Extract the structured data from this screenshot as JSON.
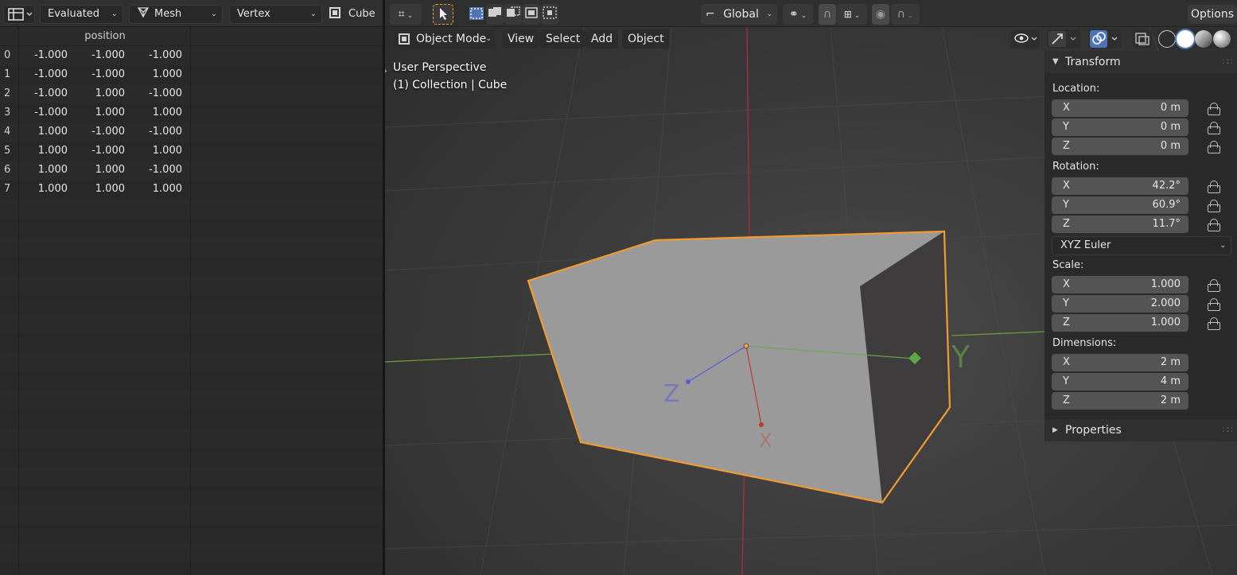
{
  "spreadsheet": {
    "header": {
      "evaluated_dd": "Evaluated",
      "geometry_dd": "Mesh",
      "domain_dd": "Vertex",
      "object_name": "Cube"
    },
    "column_header": "position",
    "rows": [
      {
        "index": "0",
        "x": "-1.000",
        "y": "-1.000",
        "z": "-1.000"
      },
      {
        "index": "1",
        "x": "-1.000",
        "y": "-1.000",
        "z": "1.000"
      },
      {
        "index": "2",
        "x": "-1.000",
        "y": "1.000",
        "z": "-1.000"
      },
      {
        "index": "3",
        "x": "-1.000",
        "y": "1.000",
        "z": "1.000"
      },
      {
        "index": "4",
        "x": "1.000",
        "y": "-1.000",
        "z": "-1.000"
      },
      {
        "index": "5",
        "x": "1.000",
        "y": "-1.000",
        "z": "1.000"
      },
      {
        "index": "6",
        "x": "1.000",
        "y": "1.000",
        "z": "-1.000"
      },
      {
        "index": "7",
        "x": "1.000",
        "y": "1.000",
        "z": "1.000"
      }
    ]
  },
  "viewport": {
    "header": {
      "orientation_dd": "Global",
      "options_label": "Options"
    },
    "menu": {
      "mode": "Object Mode",
      "view": "View",
      "select": "Select",
      "add": "Add",
      "object": "Object"
    },
    "overlay": {
      "line1": "User Perspective",
      "line2": "(1) Collection | Cube"
    },
    "gizmo_axes": {
      "x": "X",
      "y": "Y",
      "z": "Z"
    },
    "colors": {
      "x_axis": "#c0392b",
      "y_axis": "#6aa84f",
      "z_axis": "#5b5bd6",
      "selection_outline": "#f29b2e",
      "accent": "#4f74b6"
    }
  },
  "npanel": {
    "transform_title": "Transform",
    "location_label": "Location:",
    "location": [
      {
        "axis": "X",
        "value": "0 m"
      },
      {
        "axis": "Y",
        "value": "0 m"
      },
      {
        "axis": "Z",
        "value": "0 m"
      }
    ],
    "rotation_label": "Rotation:",
    "rotation": [
      {
        "axis": "X",
        "value": "42.2°"
      },
      {
        "axis": "Y",
        "value": "60.9°"
      },
      {
        "axis": "Z",
        "value": "11.7°"
      }
    ],
    "rotation_mode": "XYZ Euler",
    "scale_label": "Scale:",
    "scale": [
      {
        "axis": "X",
        "value": "1.000"
      },
      {
        "axis": "Y",
        "value": "2.000"
      },
      {
        "axis": "Z",
        "value": "1.000"
      }
    ],
    "dimensions_label": "Dimensions:",
    "dimensions": [
      {
        "axis": "X",
        "value": "2 m"
      },
      {
        "axis": "Y",
        "value": "4 m"
      },
      {
        "axis": "Z",
        "value": "2 m"
      }
    ],
    "properties_title": "Properties"
  }
}
